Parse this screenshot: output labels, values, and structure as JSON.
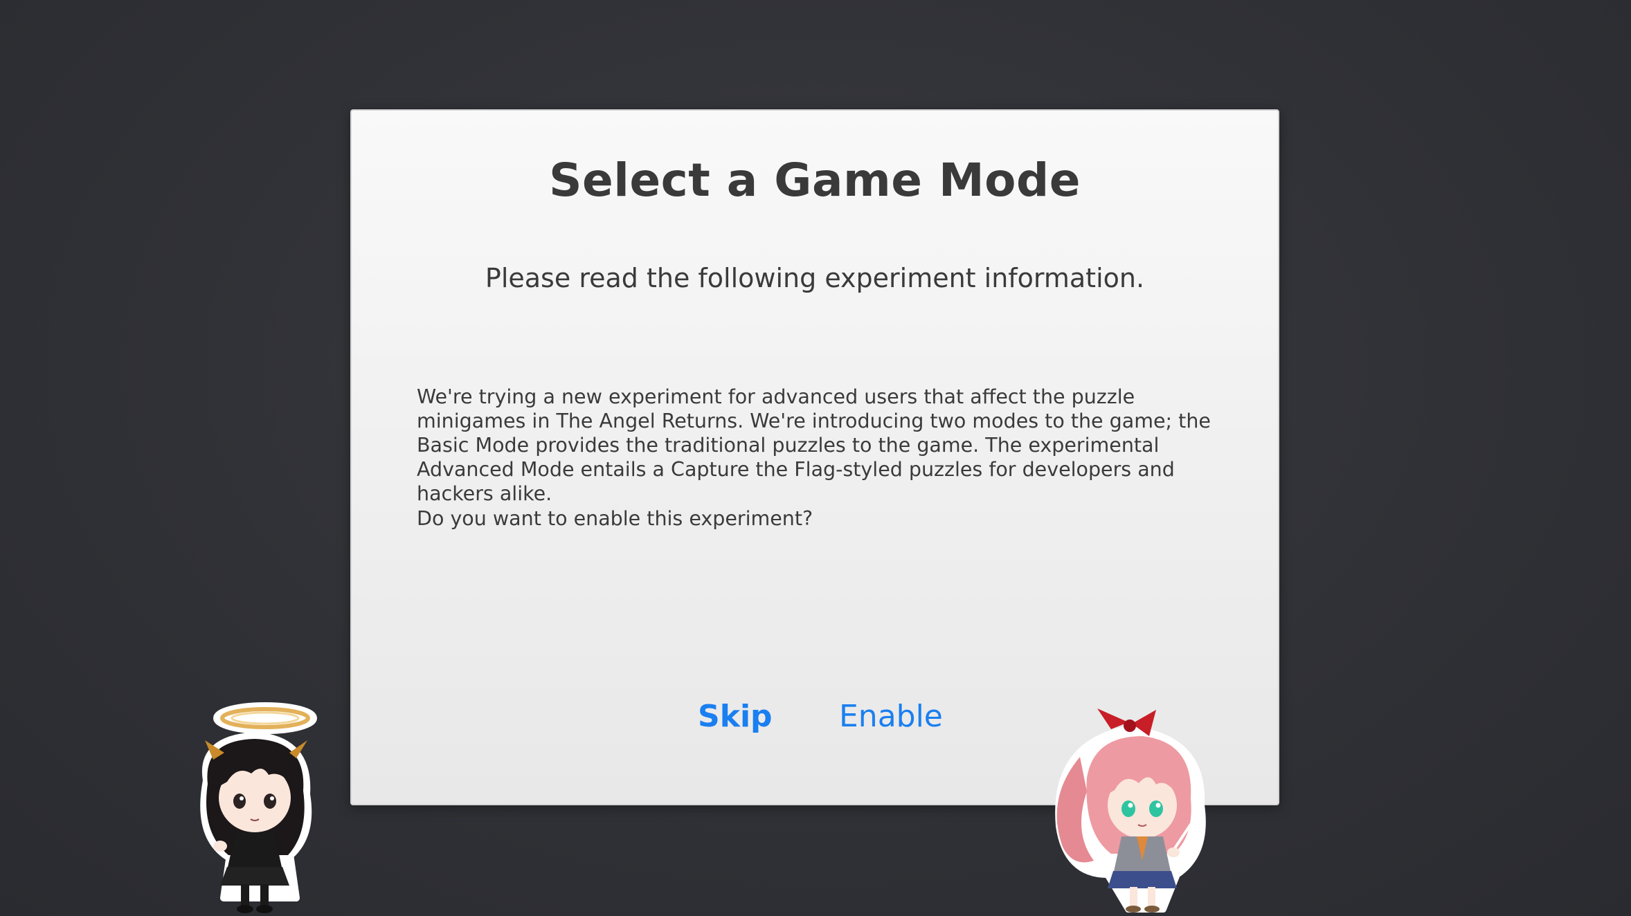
{
  "dialog": {
    "title": "Select a Game Mode",
    "subtitle": "Please read the following experiment information.",
    "body": "We're trying a new experiment for advanced users that affect the puzzle minigames in The Angel Returns. We're introducing two modes to the game; the Basic Mode provides the traditional puzzles to the game. The experimental Advanced Mode entails a Capture the Flag-styled puzzles for developers and hackers alike.",
    "question": "Do you want to enable this experiment?",
    "skip_label": "Skip",
    "enable_label": "Enable"
  },
  "characters": {
    "left": "angel-chibi-character",
    "right": "pink-hair-chibi-character"
  },
  "colors": {
    "background": "#323338",
    "dialog_bg": "#f2f2f2",
    "text": "#3a3a3a",
    "accent": "#1a7ff0"
  }
}
